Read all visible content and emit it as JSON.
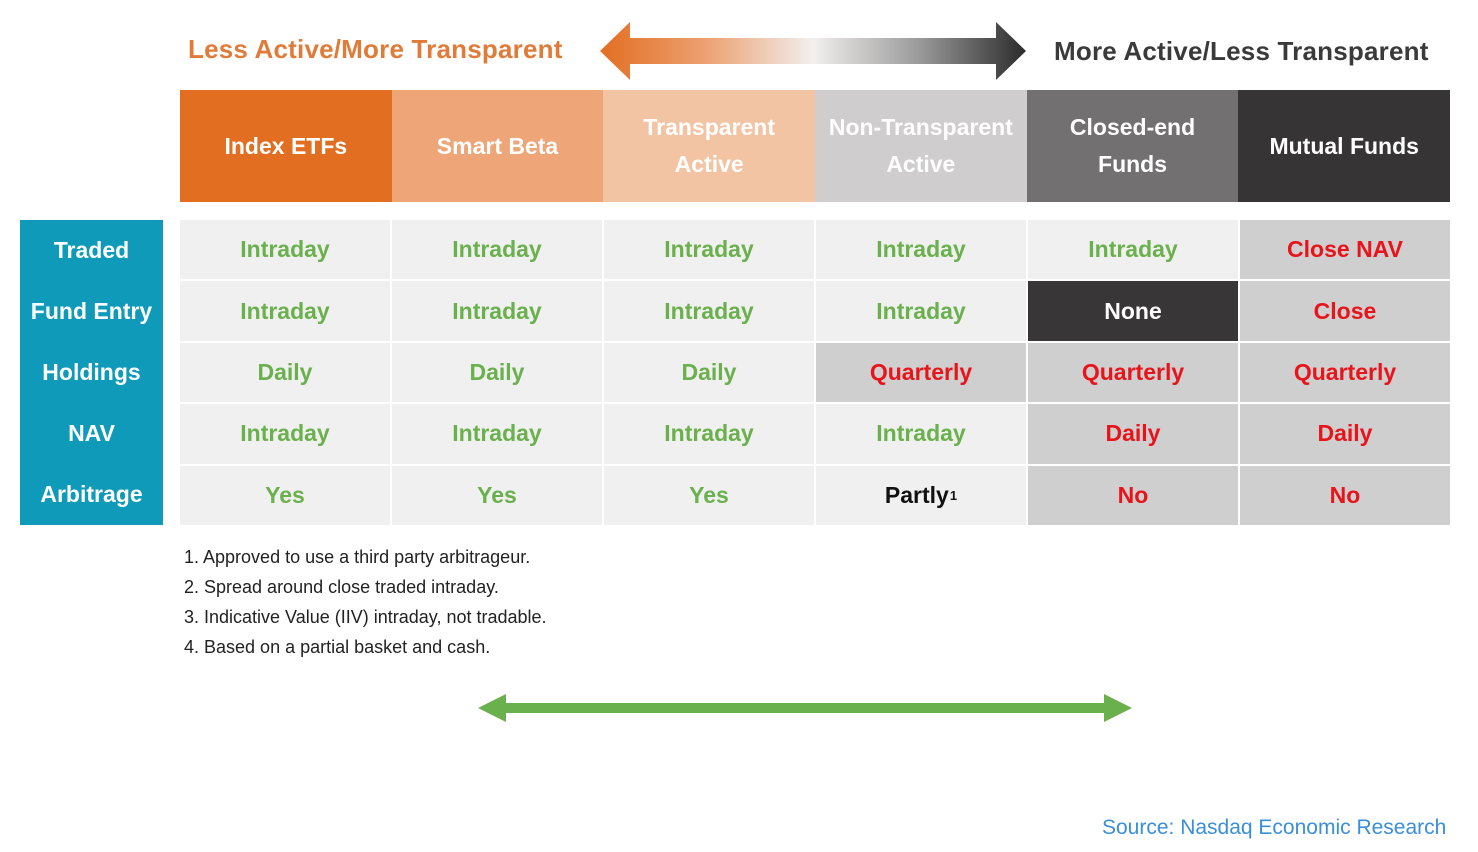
{
  "scale": {
    "left_label": "Less Active/More Transparent",
    "right_label": "More Active/Less Transparent",
    "arrow_icon": "double-headed-gradient-arrow"
  },
  "colors": {
    "orange": "#e26e22",
    "teal": "#0e9ab8",
    "green": "#6ab04c",
    "red": "#e8141a",
    "source_blue": "#3a8fd9"
  },
  "columns": [
    {
      "label_lines": [
        "Index ETFs"
      ],
      "bg": "#e26e22"
    },
    {
      "label_lines": [
        "Smart Beta"
      ],
      "bg": "#eea577"
    },
    {
      "label_lines": [
        "Transparent",
        "Active"
      ],
      "bg": "#f3c4a3"
    },
    {
      "label_lines": [
        "Non-Transparent",
        "Active"
      ],
      "bg": "#cfcdce"
    },
    {
      "label_lines": [
        "Closed-end",
        "Funds"
      ],
      "bg": "#727070"
    },
    {
      "label_lines": [
        "Mutual Funds"
      ],
      "bg": "#363435"
    }
  ],
  "rows": [
    {
      "label": "Traded",
      "cells": [
        {
          "text": "Intraday",
          "tone": "green",
          "bg": "light"
        },
        {
          "text": "Intraday",
          "tone": "green",
          "bg": "light"
        },
        {
          "text": "Intraday",
          "tone": "green",
          "bg": "light"
        },
        {
          "text": "Intraday",
          "tone": "green",
          "bg": "light"
        },
        {
          "text": "Intraday",
          "tone": "green",
          "bg": "light"
        },
        {
          "text": "Close NAV",
          "tone": "red",
          "bg": "mid"
        }
      ]
    },
    {
      "label": "Fund Entry",
      "cells": [
        {
          "text": "Intraday",
          "tone": "green",
          "bg": "light"
        },
        {
          "text": "Intraday",
          "tone": "green",
          "bg": "light"
        },
        {
          "text": "Intraday",
          "tone": "green",
          "bg": "light"
        },
        {
          "text": "Intraday",
          "tone": "green",
          "bg": "light"
        },
        {
          "text": "None",
          "tone": "white",
          "bg": "dark"
        },
        {
          "text": "Close",
          "tone": "red",
          "bg": "mid"
        }
      ]
    },
    {
      "label": "Holdings",
      "cells": [
        {
          "text": "Daily",
          "tone": "green",
          "bg": "light"
        },
        {
          "text": "Daily",
          "tone": "green",
          "bg": "light"
        },
        {
          "text": "Daily",
          "tone": "green",
          "bg": "light"
        },
        {
          "text": "Quarterly",
          "tone": "red",
          "bg": "mid"
        },
        {
          "text": "Quarterly",
          "tone": "red",
          "bg": "mid"
        },
        {
          "text": "Quarterly",
          "tone": "red",
          "bg": "mid"
        }
      ]
    },
    {
      "label": "NAV",
      "cells": [
        {
          "text": "Intraday",
          "tone": "green",
          "bg": "light"
        },
        {
          "text": "Intraday",
          "tone": "green",
          "bg": "light"
        },
        {
          "text": "Intraday",
          "tone": "green",
          "bg": "light"
        },
        {
          "text": "Intraday",
          "tone": "green",
          "bg": "light"
        },
        {
          "text": "Daily",
          "tone": "red",
          "bg": "mid"
        },
        {
          "text": "Daily",
          "tone": "red",
          "bg": "mid"
        }
      ]
    },
    {
      "label": "Arbitrage",
      "cells": [
        {
          "text": "Yes",
          "tone": "green",
          "bg": "light"
        },
        {
          "text": "Yes",
          "tone": "green",
          "bg": "light"
        },
        {
          "text": "Yes",
          "tone": "green",
          "bg": "light"
        },
        {
          "text": "Partly",
          "sup": "1",
          "tone": "black",
          "bg": "light"
        },
        {
          "text": "No",
          "tone": "red",
          "bg": "mid"
        },
        {
          "text": "No",
          "tone": "red",
          "bg": "mid"
        }
      ]
    }
  ],
  "footnotes": [
    "1. Approved to use a third party arbitrageur.",
    "2. Spread around close traded intraday.",
    "3. Indicative Value (IIV) intraday, not tradable.",
    "4. Based on a partial basket and cash."
  ],
  "bottom_arrow_icon": "green-double-headed-arrow",
  "source": "Source: Nasdaq Economic Research"
}
